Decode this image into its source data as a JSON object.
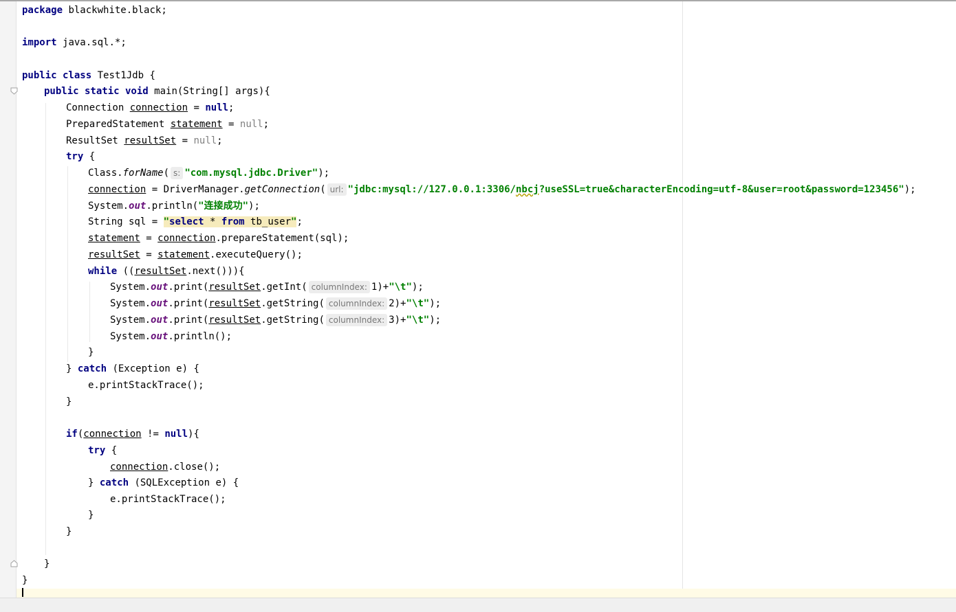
{
  "editor": {
    "package_kw": "package",
    "package_name": "blackwhite.black",
    "import_kw": "import",
    "import_name": "java.sql.*",
    "class_decl_kw": "public class",
    "class_name": "Test1Jdb",
    "method_kw": "public static void",
    "method_sig": "main(String[] args)",
    "connection_type": "Connection",
    "prepared_type": "PreparedStatement",
    "resultset_type": "ResultSet",
    "var_connection": "connection",
    "var_statement": "statement",
    "var_resultset": "resultSet",
    "null_kw": "null",
    "try_kw": "try",
    "catch_kw": "catch",
    "while_kw": "while",
    "if_kw": "if",
    "class_for_name": "Class.",
    "for_name_method": "forName",
    "hint_s": "s:",
    "driver_string": "\"com.mysql.jdbc.Driver\"",
    "driver_manager": "DriverManager.",
    "get_connection_method": "getConnection",
    "hint_url": "url:",
    "url_part1": "\"jdbc:mysql://127.0.0.1:3306/",
    "url_db": "nbcj",
    "url_part2": "?useSSL=true&characterEncoding=utf-8&user=root&password=123456\"",
    "system_prefix": "System.",
    "out_field": "out",
    "println_call": ".println(",
    "print_call": ".print(",
    "success_string": "\"连接成功\"",
    "string_type": "String sql = ",
    "sql_quote": "\"",
    "sql_select": "select",
    "sql_star": " * ",
    "sql_from": "from",
    "sql_table": " tb_user",
    "prepare_call": ".prepareStatement(sql);",
    "execute_call": ".executeQuery();",
    "next_call": ".next())){",
    "get_int": ".getInt(",
    "get_string": ".getString(",
    "hint_column": "columnIndex:",
    "idx1": "1",
    "idx2": "2",
    "idx3": "3",
    "tab_string": "\"\\t\"",
    "println_empty": ".println();",
    "exception_param": "(Exception e)",
    "sqlexception_param": "(SQLException e)",
    "print_stack": "e.printStackTrace();",
    "close_call": ".close();",
    "not_equal": " != "
  },
  "colors": {
    "keyword": "#000080",
    "string": "#008000",
    "field": "#660e7a",
    "null_gray": "#808080",
    "hint_bg": "#ededed",
    "caret_row": "#fffbe6"
  }
}
